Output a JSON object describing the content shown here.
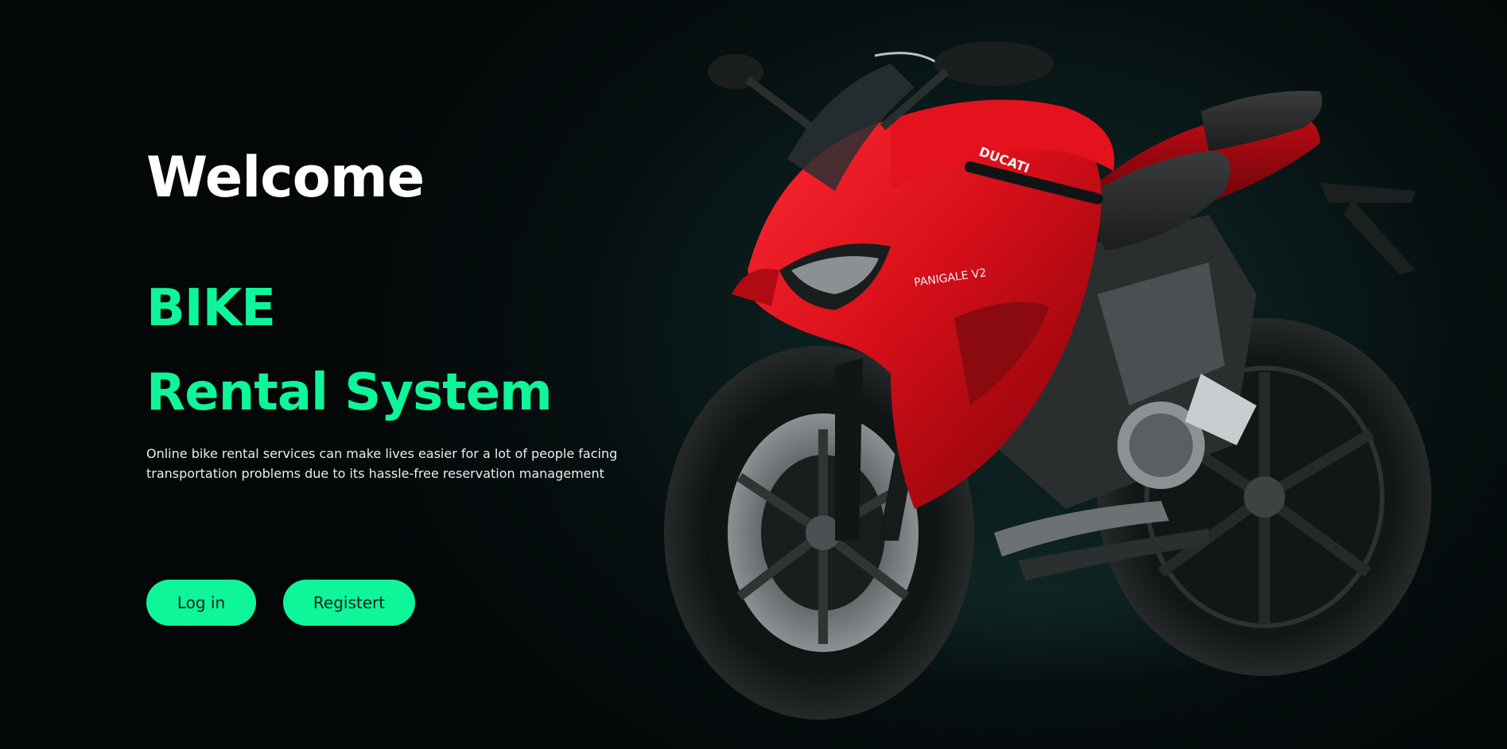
{
  "hero": {
    "title": "Welcome",
    "subtitle_line1": "BIKE",
    "subtitle_line2": "Rental System",
    "description": "Online bike rental services can make lives easier for a lot of people facing transportation problems due to its hassle-free reservation management"
  },
  "actions": {
    "login_label": "Log in",
    "register_label": "Registert"
  },
  "image": {
    "subject": "motorcycle-photo",
    "bike_brand_text": "DUCATI",
    "bike_model_text": "PANIGALE V2"
  },
  "colors": {
    "accent": "#0ff59a",
    "background": "#060e0f",
    "title_text": "#ffffff",
    "bike_red": "#d80f1a"
  }
}
